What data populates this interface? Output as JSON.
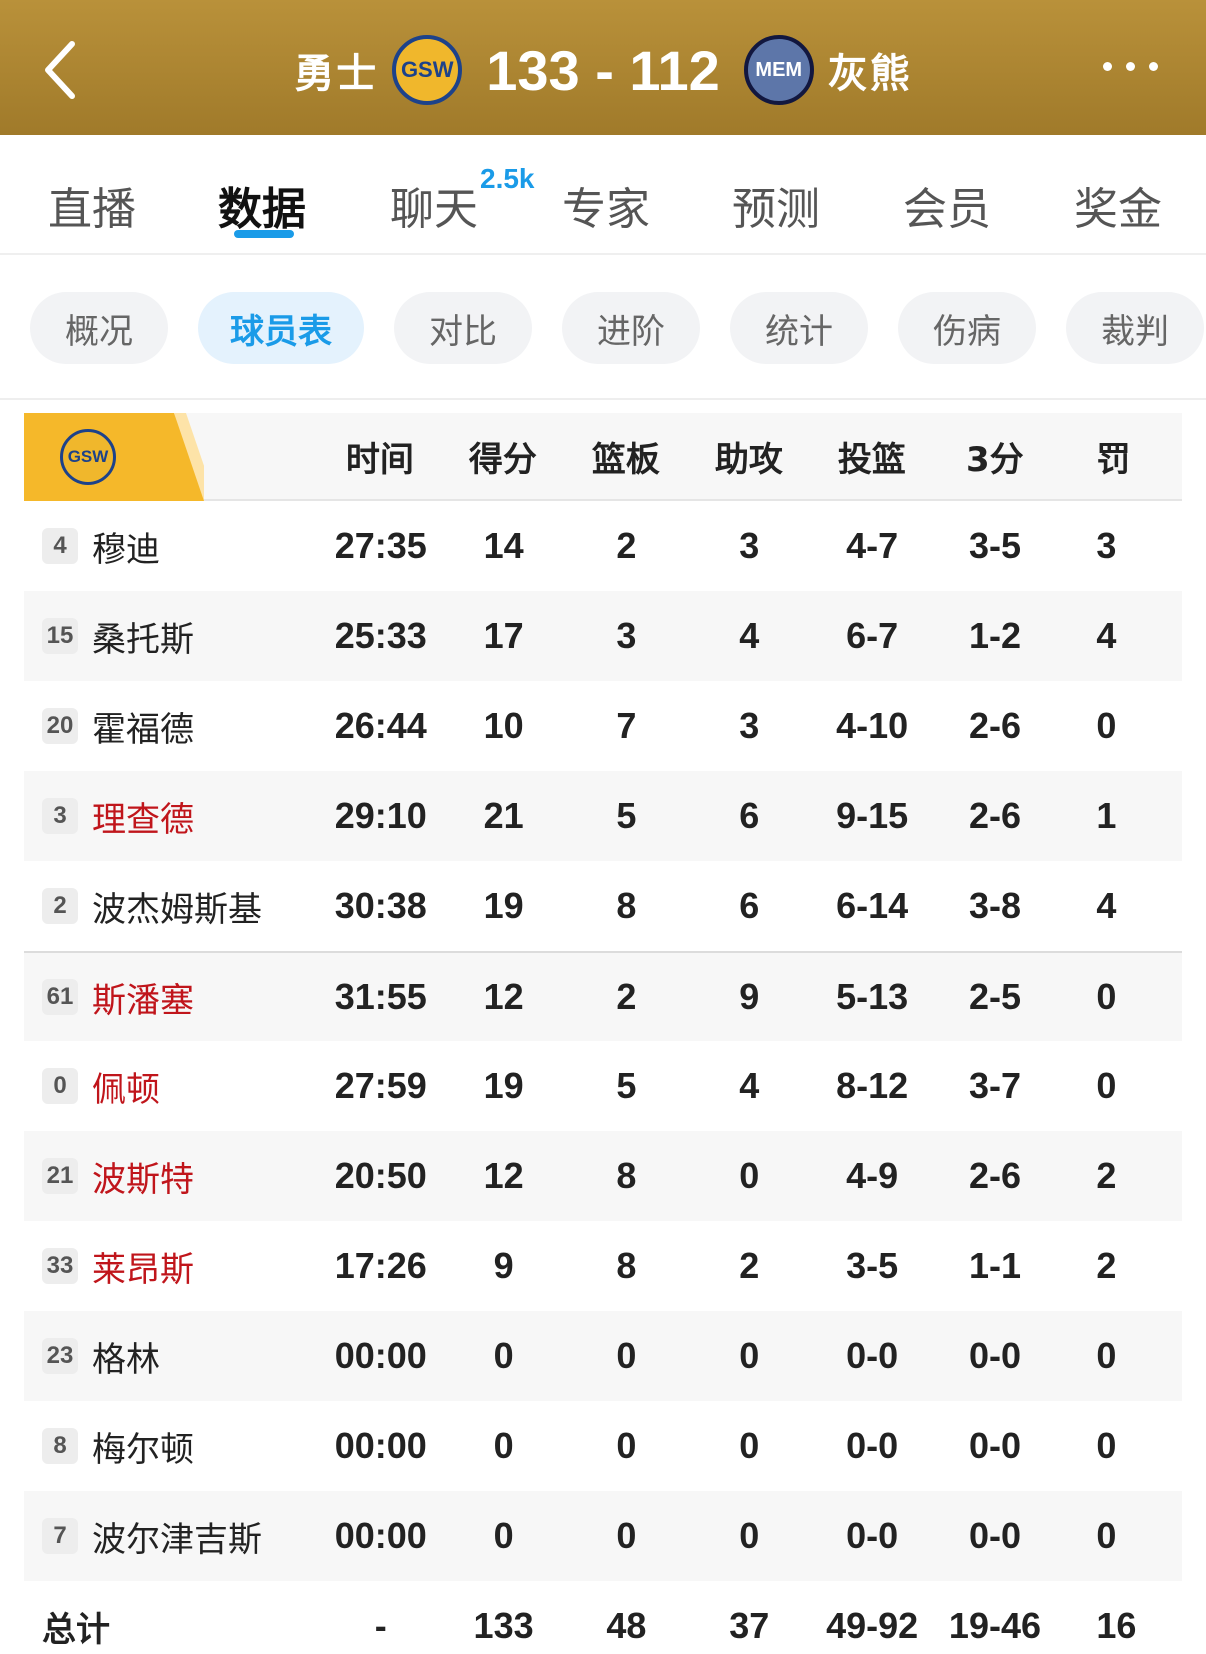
{
  "header": {
    "home_team": "勇士",
    "home_logo": "GSW",
    "score": "133 - 112",
    "away_logo": "MEM",
    "away_team": "灰熊",
    "accent": "#b9913a"
  },
  "main_tabs": [
    {
      "label": "直播"
    },
    {
      "label": "数据",
      "active": true
    },
    {
      "label": "聊天",
      "badge": "2.5k"
    },
    {
      "label": "专家"
    },
    {
      "label": "预测"
    },
    {
      "label": "会员"
    },
    {
      "label": "奖金"
    }
  ],
  "sub_tabs": [
    {
      "label": "概况"
    },
    {
      "label": "球员表",
      "active": true
    },
    {
      "label": "对比"
    },
    {
      "label": "进阶"
    },
    {
      "label": "统计"
    },
    {
      "label": "伤病"
    },
    {
      "label": "裁判"
    }
  ],
  "table": {
    "team_logo": "GSW",
    "columns": [
      "时间",
      "得分",
      "篮板",
      "助攻",
      "投篮",
      "3分",
      "罚"
    ],
    "rows": [
      {
        "num": "4",
        "name": "穆迪",
        "starter": false,
        "cells": [
          "27:35",
          "14",
          "2",
          "3",
          "4-7",
          "3-5",
          "3"
        ]
      },
      {
        "num": "15",
        "name": "桑托斯",
        "starter": false,
        "cells": [
          "25:33",
          "17",
          "3",
          "4",
          "6-7",
          "1-2",
          "4"
        ]
      },
      {
        "num": "20",
        "name": "霍福德",
        "starter": false,
        "cells": [
          "26:44",
          "10",
          "7",
          "3",
          "4-10",
          "2-6",
          "0"
        ]
      },
      {
        "num": "3",
        "name": "理查德",
        "starter": true,
        "cells": [
          "29:10",
          "21",
          "5",
          "6",
          "9-15",
          "2-6",
          "1"
        ]
      },
      {
        "num": "2",
        "name": "波杰姆斯基",
        "starter": false,
        "cells": [
          "30:38",
          "19",
          "8",
          "6",
          "6-14",
          "3-8",
          "4"
        ]
      },
      {
        "num": "61",
        "name": "斯潘塞",
        "starter": true,
        "cells": [
          "31:55",
          "12",
          "2",
          "9",
          "5-13",
          "2-5",
          "0"
        ]
      },
      {
        "num": "0",
        "name": "佩顿",
        "starter": true,
        "cells": [
          "27:59",
          "19",
          "5",
          "4",
          "8-12",
          "3-7",
          "0"
        ]
      },
      {
        "num": "21",
        "name": "波斯特",
        "starter": true,
        "cells": [
          "20:50",
          "12",
          "8",
          "0",
          "4-9",
          "2-6",
          "2"
        ]
      },
      {
        "num": "33",
        "name": "莱昂斯",
        "starter": true,
        "cells": [
          "17:26",
          "9",
          "8",
          "2",
          "3-5",
          "1-1",
          "2"
        ]
      },
      {
        "num": "23",
        "name": "格林",
        "starter": false,
        "cells": [
          "00:00",
          "0",
          "0",
          "0",
          "0-0",
          "0-0",
          "0"
        ]
      },
      {
        "num": "8",
        "name": "梅尔顿",
        "starter": false,
        "cells": [
          "00:00",
          "0",
          "0",
          "0",
          "0-0",
          "0-0",
          "0"
        ]
      },
      {
        "num": "7",
        "name": "波尔津吉斯",
        "starter": false,
        "cells": [
          "00:00",
          "0",
          "0",
          "0",
          "0-0",
          "0-0",
          "0"
        ]
      }
    ],
    "total": {
      "name": "总计",
      "cells": [
        "-",
        "133",
        "48",
        "37",
        "49-92",
        "19-46",
        "16"
      ]
    }
  }
}
